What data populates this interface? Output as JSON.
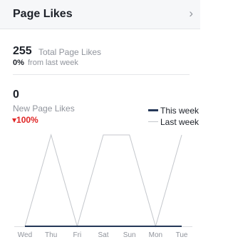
{
  "header": {
    "title": "Page Likes",
    "chevron_icon": "chevron-right-icon"
  },
  "total": {
    "value": "255",
    "label": "Total Page Likes",
    "week_change": "0%",
    "week_text": "from last week"
  },
  "new_likes": {
    "value": "0",
    "label": "New Page Likes",
    "change": "▾100%"
  },
  "colors": {
    "this_week": "#253858",
    "last_week": "#c4c7cc",
    "negative": "#e02424"
  },
  "chart_data": {
    "type": "line",
    "categories": [
      "Wed",
      "Thu",
      "Fri",
      "Sat",
      "Sun",
      "Mon",
      "Tue"
    ],
    "series": [
      {
        "name": "This week",
        "values": [
          0,
          0,
          0,
          0,
          0,
          0,
          0
        ]
      },
      {
        "name": "Last week",
        "values": [
          0,
          1,
          0,
          1,
          1,
          0,
          1
        ]
      }
    ],
    "ylim": [
      0,
      1
    ],
    "legend": "top-right",
    "grid": false
  }
}
